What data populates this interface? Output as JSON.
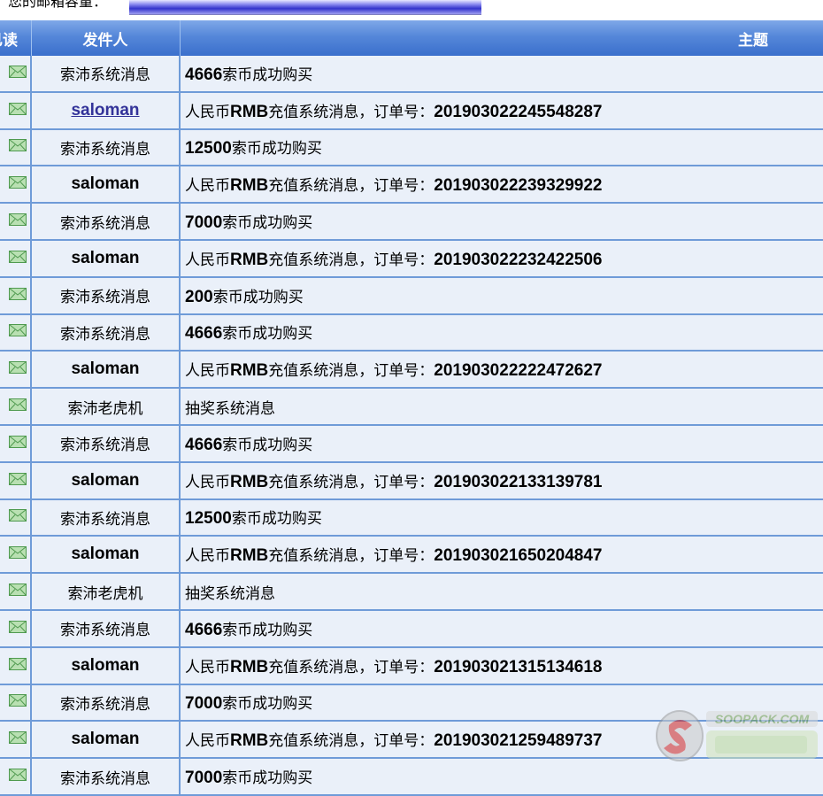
{
  "capacity": {
    "label": "您的邮箱容量："
  },
  "table": {
    "headers": {
      "read": "已读",
      "sender": "发件人",
      "subject": "主题"
    },
    "rows": [
      {
        "sender": "索沛系统消息",
        "sender_bold": false,
        "sender_link": false,
        "subject_bold": "4666",
        "subject_rest": "索币成功购买"
      },
      {
        "sender": "saloman",
        "sender_bold": true,
        "sender_link": true,
        "subject_bold": "",
        "subject_rest": "人民币RMB充值系统消息，订单号：201903022245548287"
      },
      {
        "sender": "索沛系统消息",
        "sender_bold": false,
        "sender_link": false,
        "subject_bold": "12500",
        "subject_rest": "索币成功购买"
      },
      {
        "sender": "saloman",
        "sender_bold": true,
        "sender_link": false,
        "subject_bold": "",
        "subject_rest": "人民币RMB充值系统消息，订单号：201903022239329922"
      },
      {
        "sender": "索沛系统消息",
        "sender_bold": false,
        "sender_link": false,
        "subject_bold": "7000",
        "subject_rest": "索币成功购买"
      },
      {
        "sender": "saloman",
        "sender_bold": true,
        "sender_link": false,
        "subject_bold": "",
        "subject_rest": "人民币RMB充值系统消息，订单号：201903022232422506"
      },
      {
        "sender": "索沛系统消息",
        "sender_bold": false,
        "sender_link": false,
        "subject_bold": "200",
        "subject_rest": "索币成功购买"
      },
      {
        "sender": "索沛系统消息",
        "sender_bold": false,
        "sender_link": false,
        "subject_bold": "4666",
        "subject_rest": "索币成功购买"
      },
      {
        "sender": "saloman",
        "sender_bold": true,
        "sender_link": false,
        "subject_bold": "",
        "subject_rest": "人民币RMB充值系统消息，订单号：201903022222472627"
      },
      {
        "sender": "索沛老虎机",
        "sender_bold": false,
        "sender_link": false,
        "subject_bold": "",
        "subject_rest": "抽奖系统消息"
      },
      {
        "sender": "索沛系统消息",
        "sender_bold": false,
        "sender_link": false,
        "subject_bold": "4666",
        "subject_rest": "索币成功购买"
      },
      {
        "sender": "saloman",
        "sender_bold": true,
        "sender_link": false,
        "subject_bold": "",
        "subject_rest": "人民币RMB充值系统消息，订单号：201903022133139781"
      },
      {
        "sender": "索沛系统消息",
        "sender_bold": false,
        "sender_link": false,
        "subject_bold": "12500",
        "subject_rest": "索币成功购买"
      },
      {
        "sender": "saloman",
        "sender_bold": true,
        "sender_link": false,
        "subject_bold": "",
        "subject_rest": "人民币RMB充值系统消息，订单号：201903021650204847"
      },
      {
        "sender": "索沛老虎机",
        "sender_bold": false,
        "sender_link": false,
        "subject_bold": "",
        "subject_rest": "抽奖系统消息"
      },
      {
        "sender": "索沛系统消息",
        "sender_bold": false,
        "sender_link": false,
        "subject_bold": "4666",
        "subject_rest": "索币成功购买"
      },
      {
        "sender": "saloman",
        "sender_bold": true,
        "sender_link": false,
        "subject_bold": "",
        "subject_rest": "人民币RMB充值系统消息，订单号：201903021315134618"
      },
      {
        "sender": "索沛系统消息",
        "sender_bold": false,
        "sender_link": false,
        "subject_bold": "7000",
        "subject_rest": "索币成功购买"
      },
      {
        "sender": "saloman",
        "sender_bold": true,
        "sender_link": false,
        "subject_bold": "",
        "subject_rest": "人民币RMB充值系统消息，订单号：201903021259489737"
      },
      {
        "sender": "索沛系统消息",
        "sender_bold": false,
        "sender_link": false,
        "subject_bold": "7000",
        "subject_rest": "索币成功购买"
      }
    ]
  },
  "watermark": {
    "text": "SOOPACK.COM",
    "icon": "soopack-logo-watermark"
  },
  "colors": {
    "header": "#5587d9",
    "row_bg": "#eaf0f9",
    "grid": "#6f9bd8",
    "link": "#333399",
    "envelope": "#7ec27e"
  }
}
